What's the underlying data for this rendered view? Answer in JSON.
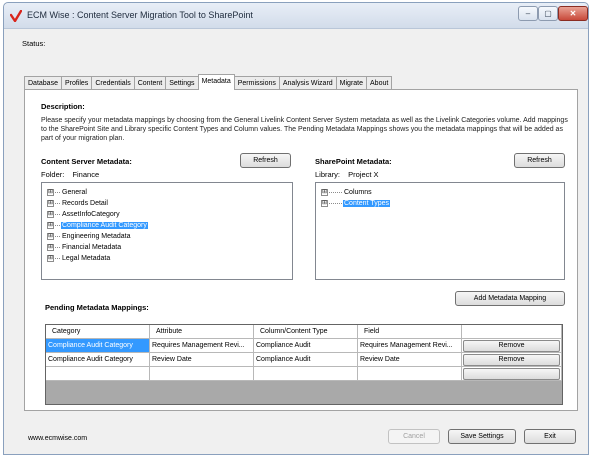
{
  "window": {
    "title": "ECM Wise : Content Server Migration Tool to SharePoint",
    "minimize_glyph": "‒",
    "maximize_glyph": "▢",
    "close_glyph": "✕",
    "accent": "#3399ff"
  },
  "status": {
    "label": "Status:"
  },
  "tabs": [
    {
      "label": "Database"
    },
    {
      "label": "Profiles"
    },
    {
      "label": "Credentials"
    },
    {
      "label": "Content"
    },
    {
      "label": "Settings"
    },
    {
      "label": "Metadata",
      "active": true
    },
    {
      "label": "Permissions"
    },
    {
      "label": "Analysis Wizard"
    },
    {
      "label": "Migrate"
    },
    {
      "label": "About"
    }
  ],
  "metadata": {
    "description_heading": "Description:",
    "description_text": "Please specify your metadata mappings by choosing from the General Livelink Content Server System metadata as well as the Livelink Categories volume.  Add mappings to the SharePoint Site and Library specific Content Types and Column values.  The Pending Metadata Mappings shows you the metadata mappings that will be added as part of your migration plan.",
    "cs_heading": "Content Server Metadata:",
    "cs_refresh": "Refresh",
    "folder_label": "Folder:",
    "folder_value": "Finance",
    "cs_tree": [
      {
        "label": "General",
        "expander": "⊞"
      },
      {
        "label": "Records Detail",
        "expander": "⊞"
      },
      {
        "label": "AssetInfoCategory",
        "expander": "⊞"
      },
      {
        "label": "Compliance Audit Category",
        "expander": "⊞",
        "selected": true
      },
      {
        "label": "Engineering Metadata",
        "expander": "⊞"
      },
      {
        "label": "Financial Metadata",
        "expander": "⊞"
      },
      {
        "label": "Legal Metadata",
        "expander": "⊞"
      }
    ],
    "sp_heading": "SharePoint Metadata:",
    "sp_refresh": "Refresh",
    "library_label": "Library:",
    "library_value": "Project X",
    "sp_tree": [
      {
        "label": "Columns",
        "expander": "⊞"
      },
      {
        "label": "Content Types",
        "expander": "⊞",
        "selected": true
      }
    ],
    "add_mapping": "Add Metadata Mapping",
    "pending_heading": "Pending Metadata Mappings:",
    "grid": {
      "columns": [
        "Category",
        "Attribute",
        "Column/Content Type",
        "Field",
        ""
      ],
      "rows": [
        {
          "cells": [
            "Compliance Audit Category",
            "Requires Management Revi...",
            "Compliance Audit",
            "Requires Management Revi..."
          ],
          "action": "Remove",
          "selected": true
        },
        {
          "cells": [
            "Compliance Audit Category",
            "Review Date",
            "Compliance Audit",
            "Review Date"
          ],
          "action": "Remove",
          "selected": false
        },
        {
          "cells": [
            "",
            "",
            "",
            ""
          ],
          "action": "",
          "selected": false
        }
      ]
    }
  },
  "footer": {
    "website": "www.ecmwise.com",
    "cancel": "Cancel",
    "save": "Save Settings",
    "exit": "Exit"
  }
}
